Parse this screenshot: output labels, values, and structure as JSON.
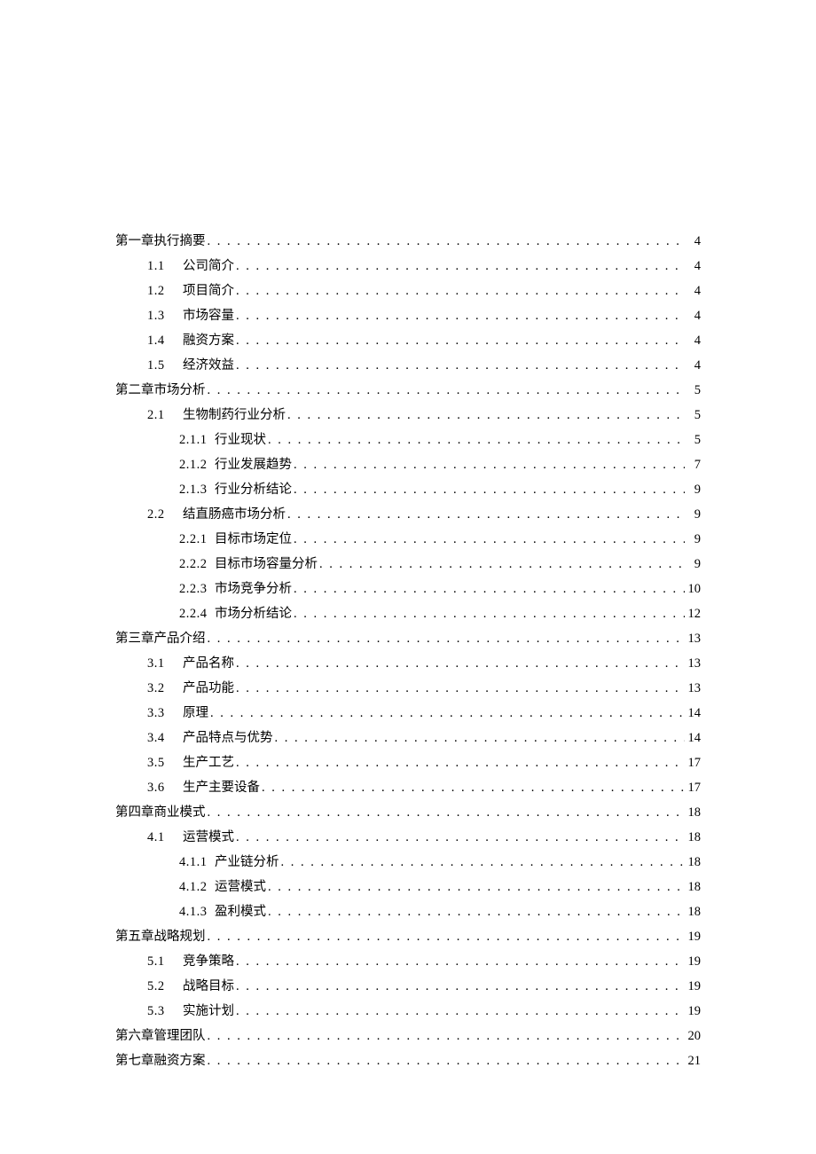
{
  "toc": [
    {
      "level": 0,
      "num": "",
      "label": "第一章执行摘要",
      "page": "4"
    },
    {
      "level": 1,
      "num": "1.1",
      "label": "公司简介",
      "page": "4"
    },
    {
      "level": 1,
      "num": "1.2",
      "label": "项目简介",
      "page": "4"
    },
    {
      "level": 1,
      "num": "1.3",
      "label": "市场容量",
      "page": "4"
    },
    {
      "level": 1,
      "num": "1.4",
      "label": "融资方案",
      "page": "4"
    },
    {
      "level": 1,
      "num": "1.5",
      "label": "经济效益",
      "page": "4"
    },
    {
      "level": 0,
      "num": "",
      "label": "第二章市场分析",
      "page": "5"
    },
    {
      "level": 1,
      "num": "2.1",
      "label": "生物制药行业分析",
      "page": "5"
    },
    {
      "level": 2,
      "num": "2.1.1",
      "label": "行业现状",
      "page": "5"
    },
    {
      "level": 2,
      "num": "2.1.2",
      "label": "行业发展趋势",
      "page": "7"
    },
    {
      "level": 2,
      "num": "2.1.3",
      "label": "行业分析结论",
      "page": "9"
    },
    {
      "level": 1,
      "num": "2.2",
      "label": "结直肠癌市场分析",
      "page": "9"
    },
    {
      "level": 2,
      "num": "2.2.1",
      "label": "目标市场定位",
      "page": "9"
    },
    {
      "level": 2,
      "num": "2.2.2",
      "label": "目标市场容量分析",
      "page": "9"
    },
    {
      "level": 2,
      "num": "2.2.3",
      "label": "市场竞争分析",
      "page": "10"
    },
    {
      "level": 2,
      "num": "2.2.4",
      "label": "市场分析结论",
      "page": "12"
    },
    {
      "level": 0,
      "num": "",
      "label": "第三章产品介绍",
      "page": "13"
    },
    {
      "level": 1,
      "num": "3.1",
      "label": "产品名称",
      "page": "13"
    },
    {
      "level": 1,
      "num": "3.2",
      "label": "产品功能",
      "page": "13"
    },
    {
      "level": 1,
      "num": "3.3",
      "label": "原理",
      "page": "14"
    },
    {
      "level": 1,
      "num": "3.4",
      "label": "产品特点与优势",
      "page": "14"
    },
    {
      "level": 1,
      "num": "3.5",
      "label": "生产工艺",
      "page": "17"
    },
    {
      "level": 1,
      "num": "3.6",
      "label": "生产主要设备",
      "page": "17"
    },
    {
      "level": 0,
      "num": "",
      "label": "第四章商业模式",
      "page": "18"
    },
    {
      "level": 1,
      "num": "4.1",
      "label": "运营模式",
      "page": "18"
    },
    {
      "level": 2,
      "num": "4.1.1",
      "label": "产业链分析",
      "page": "18"
    },
    {
      "level": 2,
      "num": "4.1.2",
      "label": "运营模式",
      "page": "18"
    },
    {
      "level": 2,
      "num": "4.1.3",
      "label": "盈利模式",
      "page": "18"
    },
    {
      "level": 0,
      "num": "",
      "label": "第五章战略规划",
      "page": "19"
    },
    {
      "level": 1,
      "num": "5.1",
      "label": "竞争策略",
      "page": "19"
    },
    {
      "level": 1,
      "num": "5.2",
      "label": "战略目标",
      "page": "19"
    },
    {
      "level": 1,
      "num": "5.3",
      "label": "实施计划",
      "page": "19"
    },
    {
      "level": 0,
      "num": "",
      "label": "第六章管理团队",
      "page": "20"
    },
    {
      "level": 0,
      "num": "",
      "label": "第七章融资方案",
      "page": "21"
    }
  ],
  "dots": ". . . . . . . . . . . . . . . . . . . . . . . . . . . . . . . . . . . . . . . . . . . . . . . . . . . . . . . . . . . . . . . . . . . . . . . . . . . . . . . . . . . . . . . . . . . . . . . . . . . . . . . . . . . . . . . . . . . . . . . ."
}
